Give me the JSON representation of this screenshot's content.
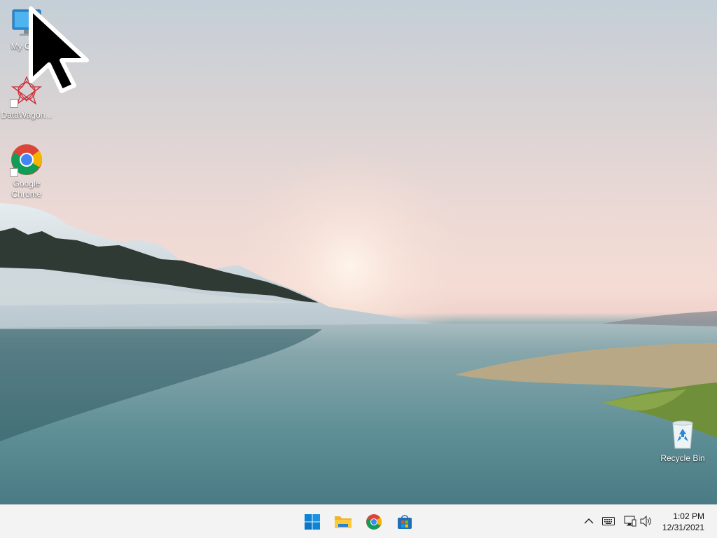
{
  "desktop": {
    "icons": [
      {
        "label": "My Co...",
        "icon": "monitor-icon"
      },
      {
        "label": "DataWagon...",
        "icon": "datawagon-icon"
      },
      {
        "label": "Google Chrome",
        "icon": "chrome-icon"
      },
      {
        "label": "Recycle Bin",
        "icon": "recycle-bin-icon"
      }
    ]
  },
  "taskbar": {
    "apps": [
      {
        "name": "Start",
        "icon": "windows-start-icon"
      },
      {
        "name": "File Explorer",
        "icon": "folder-icon"
      },
      {
        "name": "Google Chrome",
        "icon": "chrome-icon"
      },
      {
        "name": "Microsoft Store",
        "icon": "store-icon"
      }
    ],
    "tray": {
      "icons": [
        "chevron-up-icon",
        "keyboard-icon",
        "network-icon",
        "speaker-icon"
      ],
      "time": "1:02 PM",
      "date": "12/31/2021"
    }
  },
  "colors": {
    "taskbar_bg": "#f3f3f3",
    "accent": "#0078d4"
  }
}
